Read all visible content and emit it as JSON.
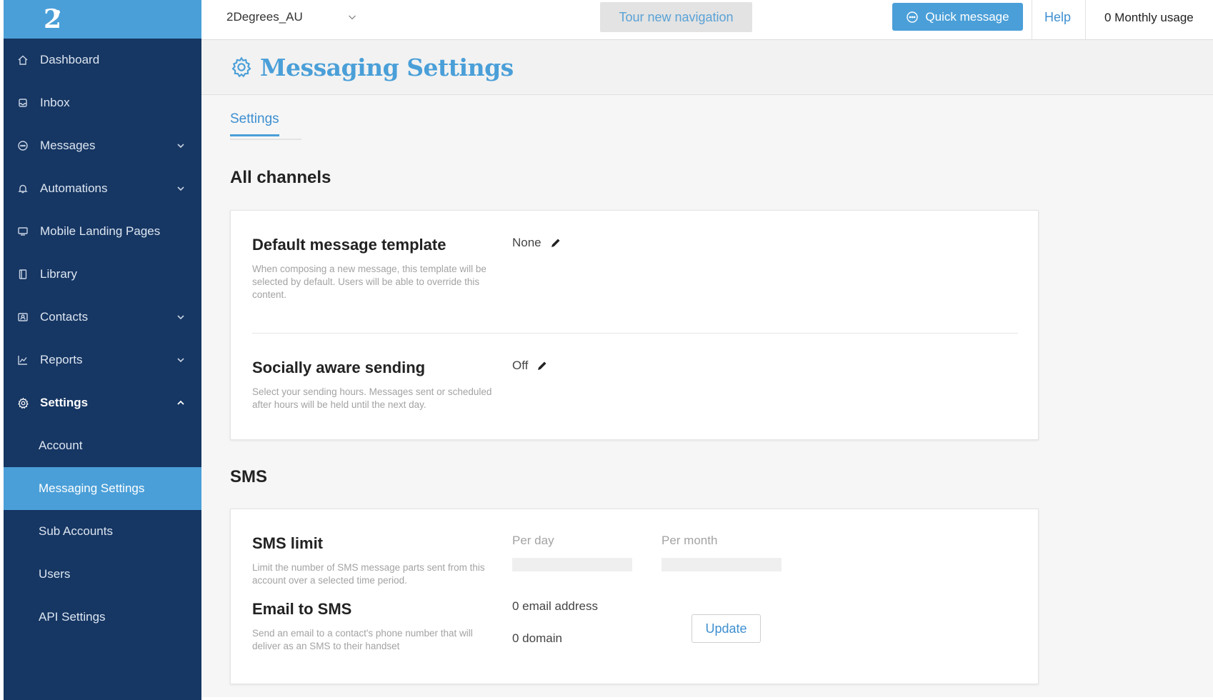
{
  "app": {
    "logo_label": "2",
    "colors": {
      "sidebar": "#163663",
      "accent": "#4a9fd8",
      "link": "#3e8fd0"
    }
  },
  "sidebar": {
    "items": [
      {
        "label": "Dashboard",
        "icon": "home-icon"
      },
      {
        "label": "Inbox",
        "icon": "inbox-icon"
      },
      {
        "label": "Messages",
        "icon": "chat-icon",
        "expandable": true
      },
      {
        "label": "Automations",
        "icon": "bell-icon",
        "expandable": true
      },
      {
        "label": "Mobile Landing Pages",
        "icon": "screen-icon"
      },
      {
        "label": "Library",
        "icon": "book-icon"
      },
      {
        "label": "Contacts",
        "icon": "contacts-icon",
        "expandable": true
      },
      {
        "label": "Reports",
        "icon": "chart-icon",
        "expandable": true
      },
      {
        "label": "Settings",
        "icon": "gear-icon",
        "expanded": true
      }
    ],
    "settings_sub": [
      {
        "label": "Account"
      },
      {
        "label": "Messaging Settings",
        "active": true
      },
      {
        "label": "Sub Accounts"
      },
      {
        "label": "Users"
      },
      {
        "label": "API Settings"
      }
    ]
  },
  "topbar": {
    "account": "2Degrees_AU",
    "tour_label": "Tour new navigation",
    "quick_label": "Quick message",
    "help_label": "Help",
    "usage_label": "0 Monthly usage"
  },
  "page": {
    "title": "Messaging Settings",
    "tab": "Settings"
  },
  "all_channels": {
    "title": "All channels",
    "default_template": {
      "title": "Default message template",
      "desc": "When composing a new message, this template will be selected by default. Users will be able to override this content.",
      "value": "None"
    },
    "socially_aware": {
      "title": "Socially aware sending",
      "desc": "Select your sending hours. Messages sent or scheduled after hours will be held until the next day.",
      "value": "Off"
    }
  },
  "sms": {
    "title": "SMS",
    "limit": {
      "title": "SMS limit",
      "desc": "Limit the number of SMS message parts sent from this account over a selected time period.",
      "per_day_label": "Per day",
      "per_month_label": "Per month"
    },
    "email_to_sms": {
      "title": "Email to SMS",
      "desc": "Send an email to a contact's phone number that will deliver as an SMS to their handset",
      "email_count": "0 email address",
      "domain_count": "0 domain",
      "update_label": "Update"
    }
  }
}
